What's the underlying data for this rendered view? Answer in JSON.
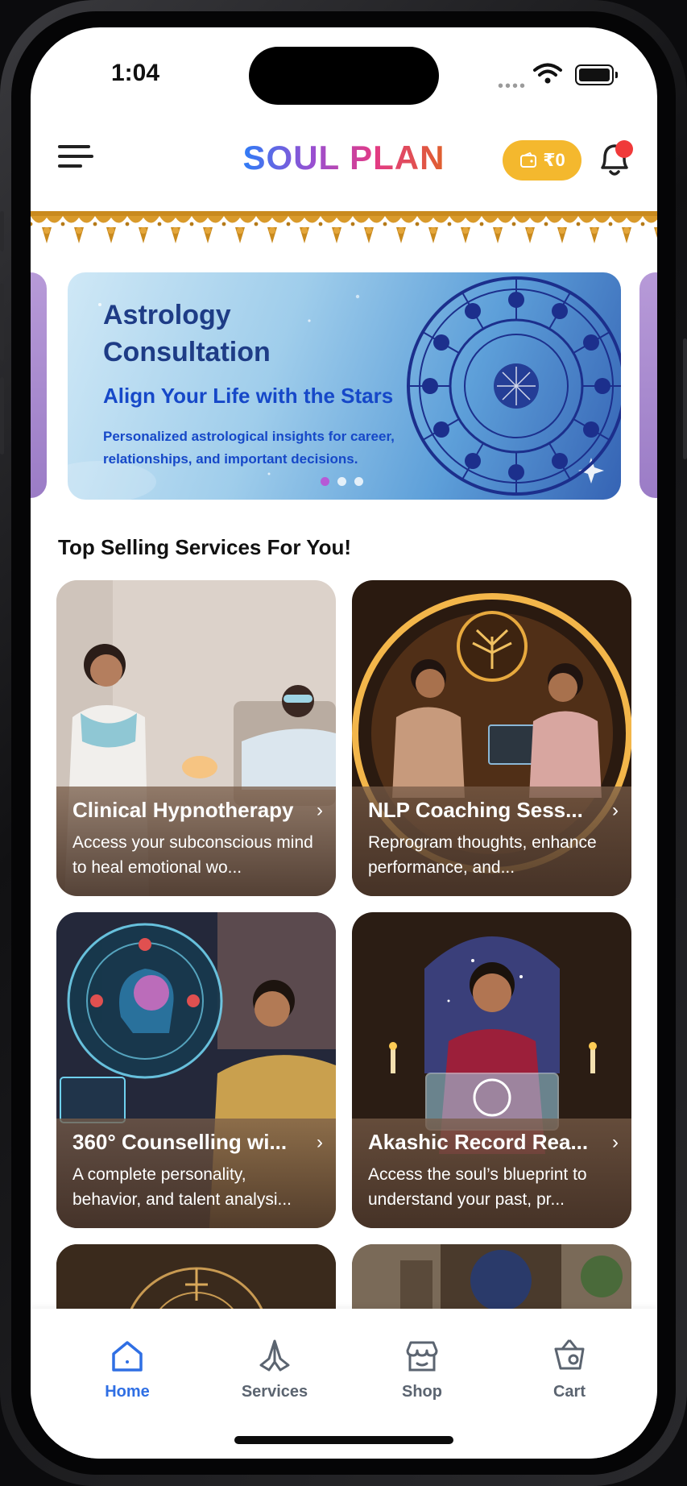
{
  "status_bar": {
    "time": "1:04"
  },
  "header": {
    "title": "SOUL PLAN",
    "wallet_label": "₹0",
    "has_notification": true
  },
  "banner": {
    "title": "Astrology Consultation",
    "subtitle": "Align Your Life with the Stars",
    "description": "Personalized astrological insights for career, relationships, and important decisions.",
    "active_slide": 1,
    "slide_count": 3
  },
  "section": {
    "title": "Top Selling Services For You!"
  },
  "services": [
    {
      "title": "Clinical Hypnotherapy",
      "description": "Access your subconscious mind to heal emotional wo..."
    },
    {
      "title": "NLP Coaching Sess...",
      "description": "Reprogram thoughts, enhance performance, and..."
    },
    {
      "title": "360° Counselling wi...",
      "description": "A complete personality, behavior, and talent analysi..."
    },
    {
      "title": "Akashic Record Rea...",
      "description": "Access the soul’s blueprint to understand your past, pr..."
    }
  ],
  "bottom_nav": {
    "items": [
      {
        "label": "Home",
        "icon": "home-icon",
        "active": true
      },
      {
        "label": "Services",
        "icon": "namaste-icon",
        "active": false
      },
      {
        "label": "Shop",
        "icon": "store-icon",
        "active": false
      },
      {
        "label": "Cart",
        "icon": "cart-icon",
        "active": false
      }
    ]
  },
  "colors": {
    "accent": "#2f6fe4",
    "wallet": "#f4b82e",
    "notification_dot": "#f03a3a"
  }
}
